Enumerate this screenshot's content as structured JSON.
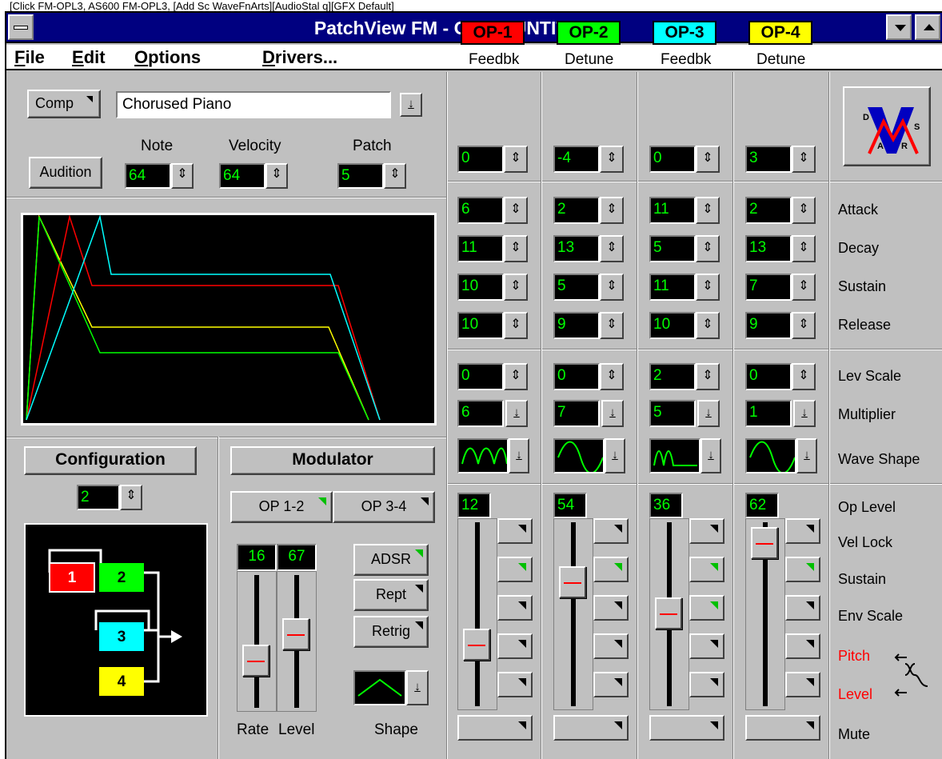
{
  "top_fragment": "[Click FM-OPL3, AS600 FM-OPL3, [Add Sc WaveFnArts][AudioStal q][GFX Default]",
  "window": {
    "title": "PatchView FM - OPL3  [UNTITLED]"
  },
  "menubar": {
    "file": "File",
    "edit": "Edit",
    "options": "Options",
    "drivers": "Drivers..."
  },
  "patch_panel": {
    "comp_label": "Comp",
    "patch_name": "Chorused Piano",
    "audition_label": "Audition",
    "note_label": "Note",
    "note_value": "64",
    "velocity_label": "Velocity",
    "velocity_value": "64",
    "patch_label": "Patch",
    "patch_value": "5"
  },
  "envelope_display": {
    "series": [
      {
        "name": "OP-1",
        "color": "#ff0000"
      },
      {
        "name": "OP-2",
        "color": "#00ff00"
      },
      {
        "name": "OP-3",
        "color": "#00ffff"
      },
      {
        "name": "OP-4",
        "color": "#ffff00"
      }
    ]
  },
  "configuration": {
    "title": "Configuration",
    "value": "2",
    "diagram_labels": [
      "1",
      "2",
      "3",
      "4"
    ]
  },
  "modulator": {
    "title": "Modulator",
    "op12_label": "OP 1-2",
    "op34_label": "OP 3-4",
    "rate_value": "16",
    "level_value": "67",
    "rate_label": "Rate",
    "level_label": "Level",
    "rate_fraction": 0.3,
    "level_fraction": 0.55,
    "adsr_label": "ADSR",
    "rept_label": "Rept",
    "retrig_label": "Retrig",
    "shape_label": "Shape"
  },
  "operators": [
    {
      "badge": "OP-1",
      "color": "#ff0000",
      "param_label": "Feedbk",
      "param_value": "0",
      "attack": "6",
      "decay": "11",
      "sustain": "10",
      "release": "10",
      "lev_scale": "0",
      "multiplier": "6",
      "wave": "abs-sine",
      "op_level": "12",
      "level_fraction": 0.3,
      "toggles": [
        false,
        true,
        false,
        false,
        false
      ]
    },
    {
      "badge": "OP-2",
      "color": "#00ff00",
      "param_label": "Detune",
      "param_value": "-4",
      "attack": "2",
      "decay": "13",
      "sustain": "5",
      "release": "9",
      "lev_scale": "0",
      "multiplier": "7",
      "wave": "sine",
      "op_level": "54",
      "level_fraction": 0.7,
      "toggles": [
        false,
        true,
        false,
        false,
        false
      ]
    },
    {
      "badge": "OP-3",
      "color": "#00ffff",
      "param_label": "Feedbk",
      "param_value": "0",
      "attack": "11",
      "decay": "5",
      "sustain": "11",
      "release": "10",
      "lev_scale": "2",
      "multiplier": "5",
      "wave": "pulse-sine",
      "op_level": "36",
      "level_fraction": 0.5,
      "toggles": [
        false,
        true,
        true,
        false,
        false
      ]
    },
    {
      "badge": "OP-4",
      "color": "#ffff00",
      "param_label": "Detune",
      "param_value": "3",
      "attack": "2",
      "decay": "13",
      "sustain": "7",
      "release": "9",
      "lev_scale": "0",
      "multiplier": "1",
      "wave": "sine",
      "op_level": "62",
      "level_fraction": 0.95,
      "toggles": [
        false,
        true,
        false,
        false,
        false
      ]
    }
  ],
  "row_labels": {
    "attack": "Attack",
    "decay": "Decay",
    "sustain": "Sustain",
    "release": "Release",
    "lev_scale": "Lev Scale",
    "multiplier": "Multiplier",
    "wave_shape": "Wave Shape",
    "op_level": "Op Level",
    "vel_lock": "Vel Lock",
    "sustain_toggle": "Sustain",
    "env_scale": "Env Scale",
    "pitch": "Pitch",
    "level": "Level",
    "mute": "Mute"
  },
  "logo": {
    "letters": "DVSAR"
  }
}
